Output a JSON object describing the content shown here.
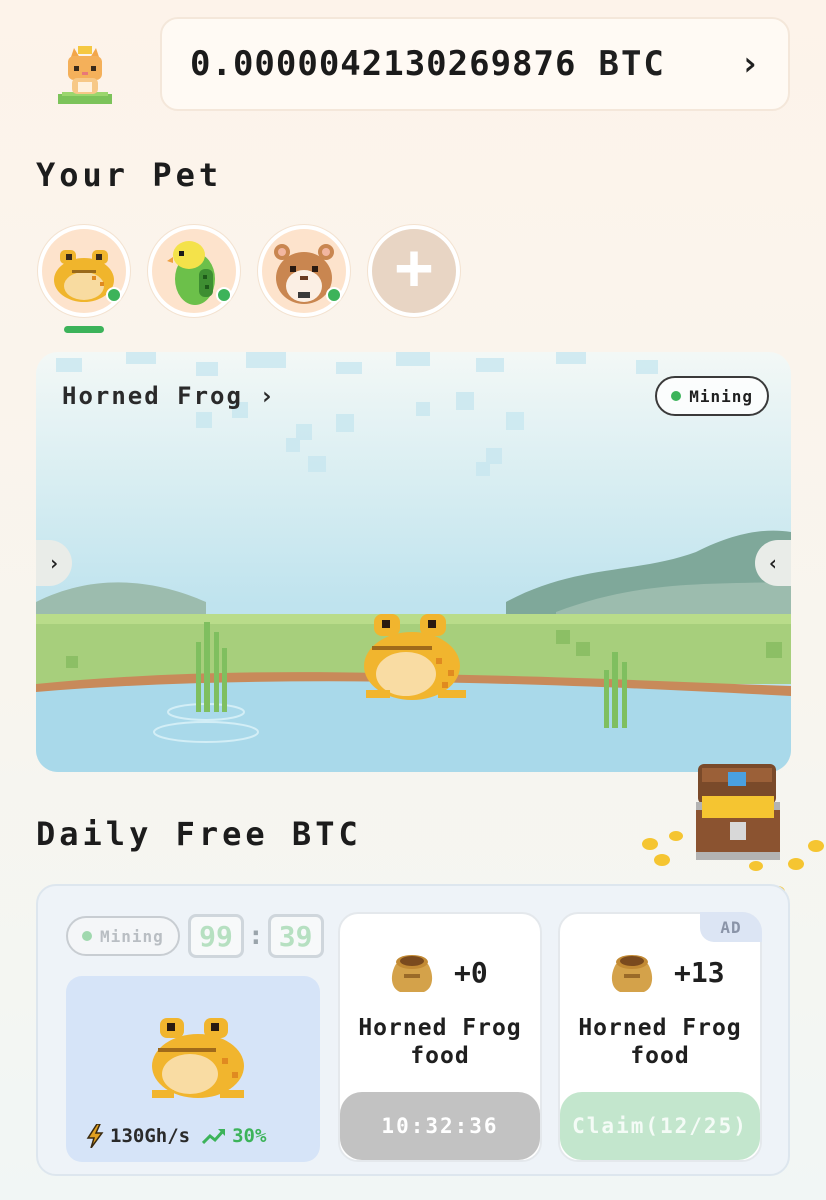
{
  "header": {
    "btc_value": "0.0000042130269876",
    "btc_unit": "BTC",
    "chevron": "›",
    "avatar_icon": "cat-avatar-icon"
  },
  "pets_section": {
    "title": "Your Pet",
    "pets": [
      {
        "name": "horned-frog",
        "icon": "horned-frog-icon",
        "online": true,
        "selected": true
      },
      {
        "name": "budgie",
        "icon": "budgie-icon",
        "online": true,
        "selected": false
      },
      {
        "name": "hamster",
        "icon": "hamster-icon",
        "online": true,
        "selected": false
      }
    ],
    "add_label": "+"
  },
  "scene": {
    "pet_name": "Horned Frog",
    "chevron": "›",
    "status": "Mining",
    "left_arrow": "›",
    "right_arrow": "‹"
  },
  "daily": {
    "title": "Daily Free BTC",
    "mining_status": "Mining",
    "timer": [
      "99",
      "39"
    ],
    "timer_sep": ":",
    "hash_rate": "130Gh/s",
    "boost": "30%",
    "cards": [
      {
        "amount": "+0",
        "name_line1": "Horned Frog",
        "name_line2": "food",
        "button": "10:32:36",
        "ad": false
      },
      {
        "amount": "+13",
        "name_line1": "Horned Frog",
        "name_line2": "food",
        "button": "Claim(12/25)",
        "ad": true,
        "ad_label": "AD"
      }
    ]
  },
  "colors": {
    "accent_green": "#3cb35a",
    "btn_gray": "#c2c2c2",
    "btn_green": "#c3e6cd"
  }
}
